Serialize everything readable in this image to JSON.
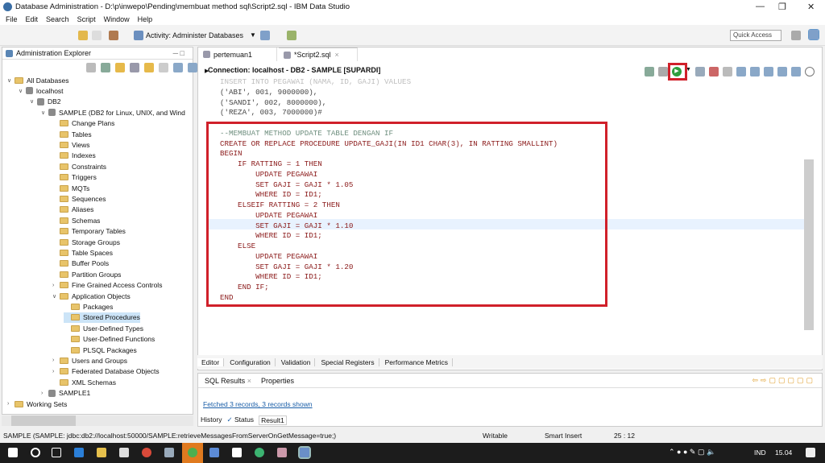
{
  "window": {
    "title": "Database Administration - D:\\p\\inwepo\\Pending\\membuat method sql\\Script2.sql - IBM Data Studio"
  },
  "menu": [
    "File",
    "Edit",
    "Search",
    "Script",
    "Window",
    "Help"
  ],
  "toolbar": {
    "activity": "Activity: Administer Databases",
    "quick_access": "Quick Access"
  },
  "explorer": {
    "title": "Administration Explorer",
    "tree": [
      {
        "label": "All Databases",
        "level": 0,
        "icon": "folder",
        "exp": "v"
      },
      {
        "label": "localhost",
        "level": 1,
        "icon": "server",
        "exp": "v"
      },
      {
        "label": "DB2",
        "level": 2,
        "icon": "server",
        "exp": "v"
      },
      {
        "label": "SAMPLE (DB2 for Linux, UNIX, and Wind",
        "level": 3,
        "icon": "db",
        "exp": "v"
      },
      {
        "label": "Change Plans",
        "level": 4,
        "icon": "folder",
        "exp": ""
      },
      {
        "label": "Tables",
        "level": 4,
        "icon": "folder",
        "exp": ""
      },
      {
        "label": "Views",
        "level": 4,
        "icon": "folder",
        "exp": ""
      },
      {
        "label": "Indexes",
        "level": 4,
        "icon": "folder",
        "exp": ""
      },
      {
        "label": "Constraints",
        "level": 4,
        "icon": "folder",
        "exp": ""
      },
      {
        "label": "Triggers",
        "level": 4,
        "icon": "folder",
        "exp": ""
      },
      {
        "label": "MQTs",
        "level": 4,
        "icon": "folder",
        "exp": ""
      },
      {
        "label": "Sequences",
        "level": 4,
        "icon": "folder",
        "exp": ""
      },
      {
        "label": "Aliases",
        "level": 4,
        "icon": "folder",
        "exp": ""
      },
      {
        "label": "Schemas",
        "level": 4,
        "icon": "folder",
        "exp": ""
      },
      {
        "label": "Temporary Tables",
        "level": 4,
        "icon": "folder",
        "exp": ""
      },
      {
        "label": "Storage Groups",
        "level": 4,
        "icon": "folder",
        "exp": ""
      },
      {
        "label": "Table Spaces",
        "level": 4,
        "icon": "folder",
        "exp": ""
      },
      {
        "label": "Buffer Pools",
        "level": 4,
        "icon": "folder",
        "exp": ""
      },
      {
        "label": "Partition Groups",
        "level": 4,
        "icon": "folder",
        "exp": ""
      },
      {
        "label": "Fine Grained Access Controls",
        "level": 4,
        "icon": "folder",
        "exp": ">"
      },
      {
        "label": "Application Objects",
        "level": 4,
        "icon": "folder",
        "exp": "v"
      },
      {
        "label": "Packages",
        "level": 5,
        "icon": "folder",
        "exp": ""
      },
      {
        "label": "Stored Procedures",
        "level": 5,
        "icon": "folder",
        "exp": "",
        "selected": true
      },
      {
        "label": "User-Defined Types",
        "level": 5,
        "icon": "folder",
        "exp": ""
      },
      {
        "label": "User-Defined Functions",
        "level": 5,
        "icon": "folder",
        "exp": ""
      },
      {
        "label": "PLSQL Packages",
        "level": 5,
        "icon": "folder",
        "exp": ""
      },
      {
        "label": "Users and Groups",
        "level": 4,
        "icon": "folder",
        "exp": ">"
      },
      {
        "label": "Federated Database Objects",
        "level": 4,
        "icon": "folder",
        "exp": ">"
      },
      {
        "label": "XML Schemas",
        "level": 4,
        "icon": "folder",
        "exp": ""
      },
      {
        "label": "SAMPLE1",
        "level": 3,
        "icon": "db",
        "exp": ">"
      },
      {
        "label": "Working Sets",
        "level": 0,
        "icon": "folder",
        "exp": ">"
      }
    ]
  },
  "editor": {
    "tabs": [
      "pertemuan1",
      "*Script2.sql"
    ],
    "connection": "Connection: localhost - DB2 - SAMPLE [SUPARDI]",
    "code": [
      {
        "t": "INSERT INTO PEGAWAI (NAMA, ID, GAJI) VALUES",
        "c": "p"
      },
      {
        "t": "('ABI', 001, 9000000),",
        "c": "p"
      },
      {
        "t": "('SANDI', 002, 8000000),",
        "c": "p"
      },
      {
        "t": "('REZA', 003, 7000000)#",
        "c": "p"
      },
      {
        "t": "",
        "c": "p"
      },
      {
        "t": "--MEMBUAT METHOD UPDATE TABLE DENGAN IF",
        "c": "c"
      },
      {
        "t": "CREATE OR REPLACE PROCEDURE UPDATE_GAJI(IN ID1 CHAR(3), IN RATTING SMALLINT)",
        "c": "k"
      },
      {
        "t": "BEGIN",
        "c": "k"
      },
      {
        "t": "    IF RATTING = 1 THEN",
        "c": "k"
      },
      {
        "t": "        UPDATE PEGAWAI",
        "c": "k"
      },
      {
        "t": "        SET GAJI = GAJI * 1.05",
        "c": "k"
      },
      {
        "t": "        WHERE ID = ID1;",
        "c": "k"
      },
      {
        "t": "    ELSEIF RATTING = 2 THEN",
        "c": "k"
      },
      {
        "t": "        UPDATE PEGAWAI",
        "c": "k"
      },
      {
        "t": "        SET GAJI = GAJI * 1.10",
        "c": "k"
      },
      {
        "t": "        WHERE ID = ID1;",
        "c": "k"
      },
      {
        "t": "    ELSE",
        "c": "k"
      },
      {
        "t": "        UPDATE PEGAWAI",
        "c": "k"
      },
      {
        "t": "        SET GAJI = GAJI * 1.20",
        "c": "k"
      },
      {
        "t": "        WHERE ID = ID1;",
        "c": "k"
      },
      {
        "t": "    END IF;",
        "c": "k"
      },
      {
        "t": "END",
        "c": "k"
      }
    ],
    "bottom_tabs": [
      "Editor",
      "Configuration",
      "Validation",
      "Special Registers",
      "Performance Metrics"
    ]
  },
  "results": {
    "tabs": [
      "SQL Results",
      "Properties"
    ],
    "message": "Fetched 3 records, 3 records shown",
    "sub_tabs": [
      "History",
      "Status",
      "Result1"
    ]
  },
  "status": {
    "connection": "SAMPLE (SAMPLE: jdbc:db2://localhost:50000/SAMPLE:retrieveMessagesFromServerOnGetMessage=true;)",
    "mode": "Writable",
    "insert": "Smart Insert",
    "position": "25 : 12"
  },
  "taskbar": {
    "lang": "IND",
    "time": "15.04"
  }
}
